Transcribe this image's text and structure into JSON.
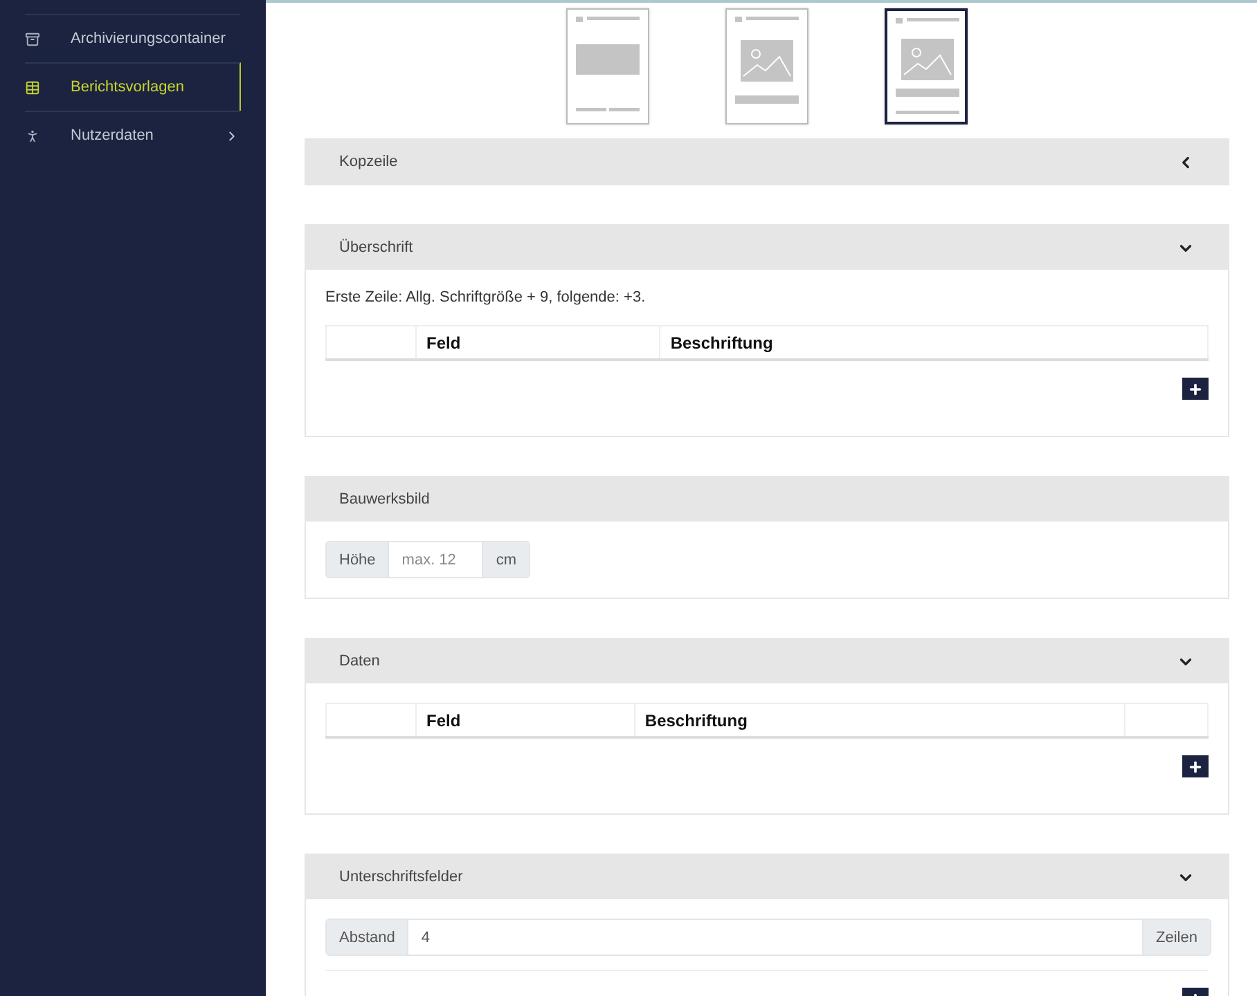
{
  "sidebar": {
    "items": [
      {
        "kind": "archive",
        "label": "Archivierungscontainer",
        "selected": false,
        "has_submenu": false
      },
      {
        "kind": "table",
        "label": "Berichtsvorlagen",
        "selected": true,
        "has_submenu": false
      },
      {
        "kind": "person",
        "label": "Nutzerdaten",
        "selected": false,
        "has_submenu": true
      }
    ]
  },
  "layouts": [
    {
      "kind": "table",
      "selected": false
    },
    {
      "kind": "picture",
      "selected": false
    },
    {
      "kind": "picture_data",
      "selected": true
    }
  ],
  "sections": [
    {
      "title": "Kopzeile",
      "expanded": false
    },
    {
      "title": "Überschrift",
      "expanded": true,
      "note": "Erste Zeile: Allg. Schriftgröße + 9, folgende: +3.",
      "table": {
        "columns": [
          "",
          "Feld",
          "Beschriftung"
        ]
      },
      "add_button": true
    },
    {
      "title": "Bauwerksbild",
      "input": {
        "label": "Höhe",
        "placeholder": "max. 12",
        "unit": "cm"
      }
    },
    {
      "title": "Daten",
      "expanded": true,
      "table": {
        "columns": [
          "",
          "Feld",
          "Beschriftung",
          ""
        ]
      },
      "add_button": true
    },
    {
      "title": "Unterschriftsfelder",
      "expanded": true,
      "input": {
        "label": "Abstand",
        "value": "4",
        "unit": "Zeilen",
        "wide": true
      },
      "divider": true,
      "add_button": true
    }
  ]
}
